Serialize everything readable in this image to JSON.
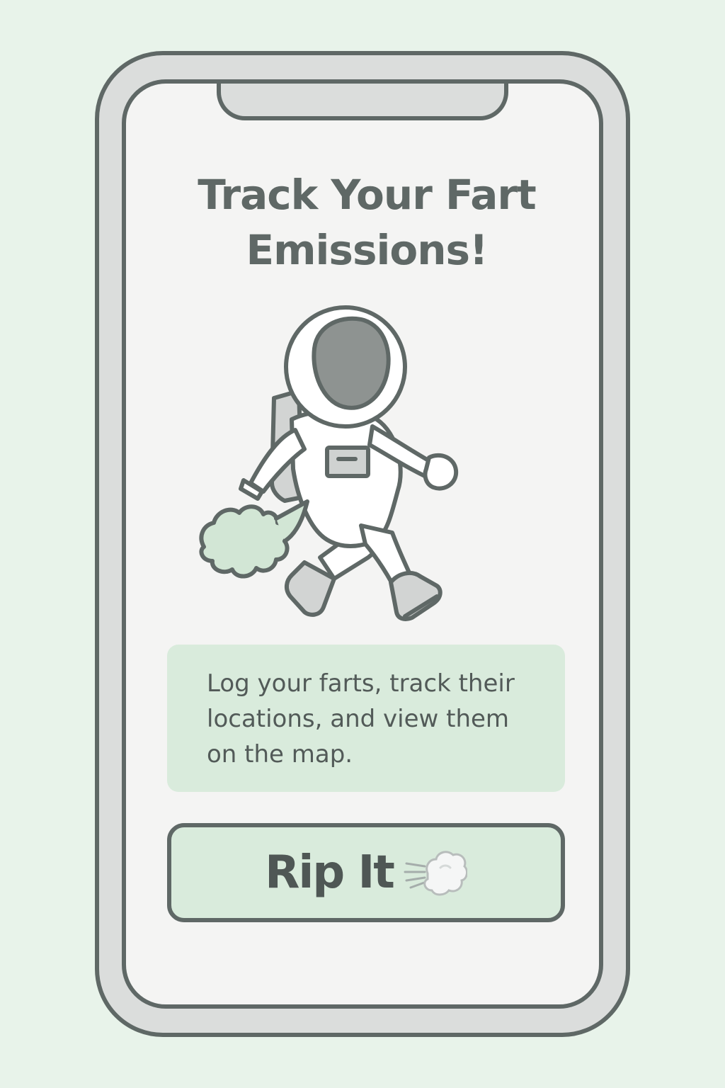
{
  "screen": {
    "title": "Track Your Fart Emissions!",
    "description": "Log your farts, track their locations, and view them on the map.",
    "illustration_icon": "astronaut-farting-icon",
    "cta": {
      "label": "Rip It",
      "icon": "dashing-cloud-icon"
    }
  },
  "colors": {
    "background": "#e8f3ea",
    "outline": "#5f6866",
    "screen": "#f4f4f3",
    "accent_green": "#d9ebdc",
    "visor_gray": "#8e9391"
  }
}
